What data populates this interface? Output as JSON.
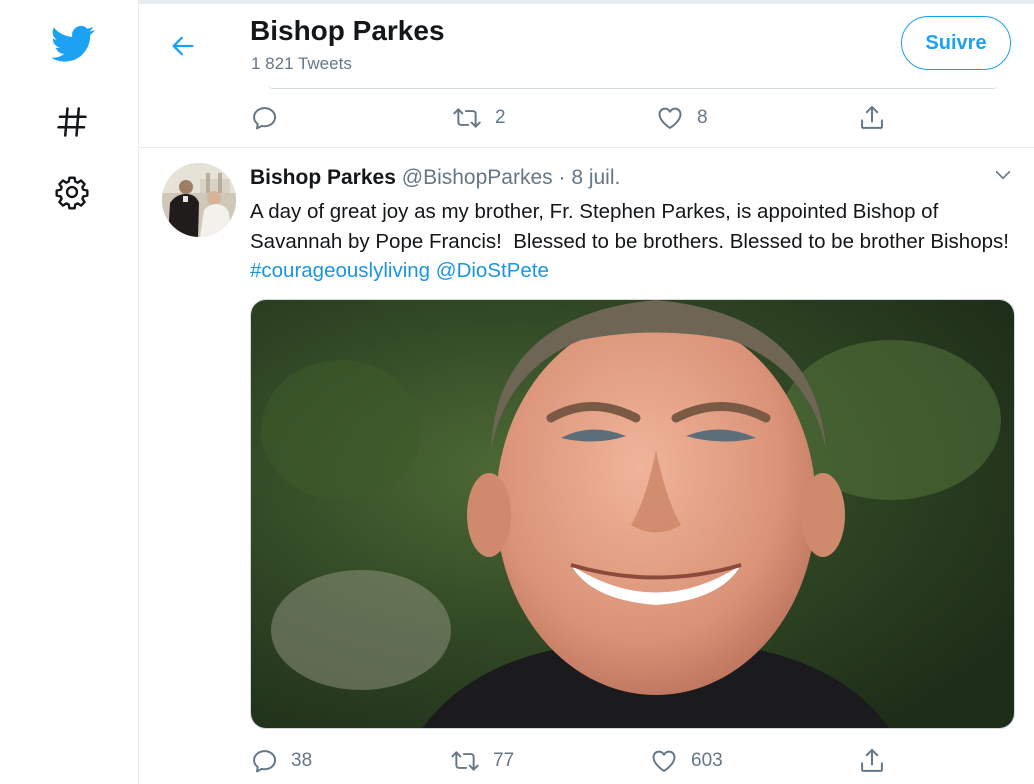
{
  "header": {
    "title": "Bishop Parkes",
    "subtitle": "1 821 Tweets",
    "follow_label": "Suivre"
  },
  "prev_tweet": {
    "actions": {
      "reply_count": "",
      "retweet_count": "2",
      "like_count": "8"
    }
  },
  "tweet": {
    "author_name": "Bishop Parkes",
    "author_handle": "@BishopParkes",
    "dot": "·",
    "date": "8 juil.",
    "text_plain": "A day of great joy as my brother, Fr. Stephen Parkes, is appointed Bishop of Savannah by Pope Francis!  Blessed to be brothers. Blessed to be brother Bishops! ",
    "hashtag": "#courageouslyliving",
    "space": " ",
    "mention": "@DioStPete",
    "actions": {
      "reply_count": "38",
      "retweet_count": "77",
      "like_count": "603"
    }
  },
  "icons": {
    "logo": "twitter-bird-icon",
    "explore": "hashtag-icon",
    "settings": "gear-icon",
    "back": "arrow-left-icon",
    "more": "chevron-down-icon",
    "reply": "reply-icon",
    "retweet": "retweet-icon",
    "like": "heart-icon",
    "share": "share-icon"
  },
  "colors": {
    "accent": "#1da1f2",
    "link": "#1b95e0",
    "muted": "#657786",
    "text": "#14171a"
  }
}
